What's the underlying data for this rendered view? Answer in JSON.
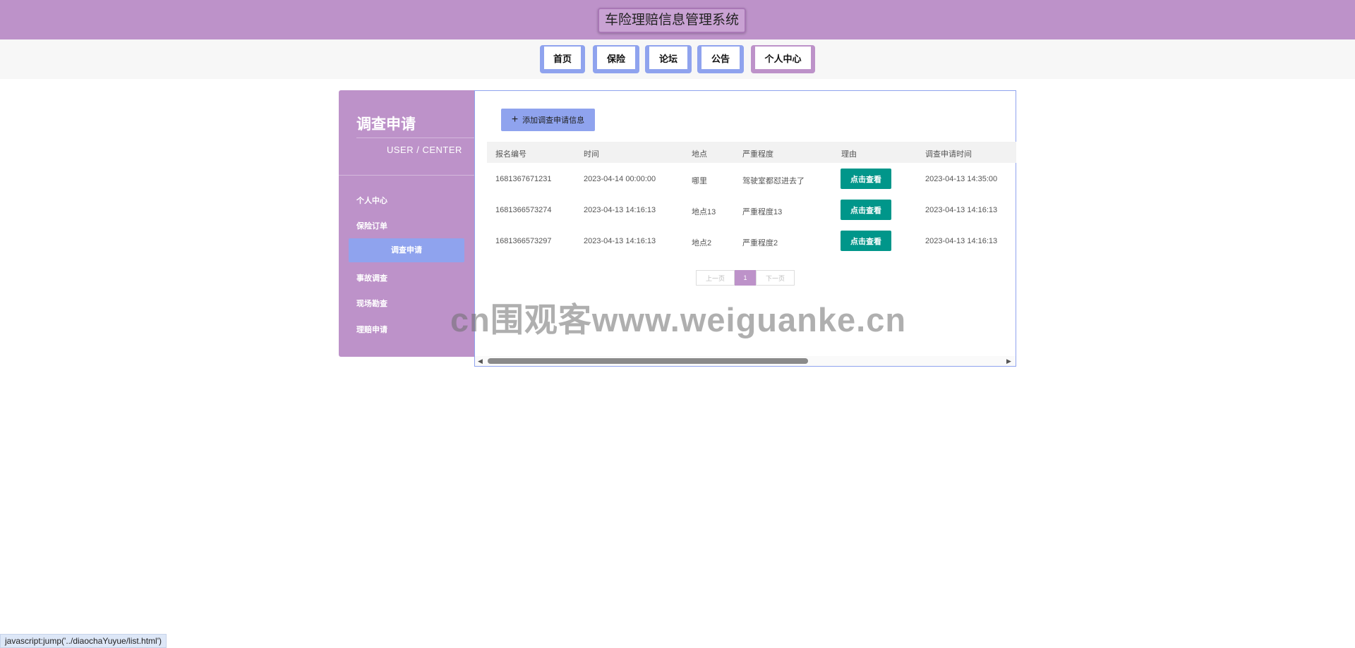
{
  "app": {
    "title": "车险理赔信息管理系统"
  },
  "nav": {
    "tabs": [
      {
        "label": "首页",
        "active": false
      },
      {
        "label": "保险",
        "active": false
      },
      {
        "label": "论坛",
        "active": false
      },
      {
        "label": "公告",
        "active": false
      },
      {
        "label": "个人中心",
        "active": true
      }
    ]
  },
  "sidebar": {
    "title": "调查申请",
    "subtitle": "USER / CENTER",
    "items": [
      {
        "label": "个人中心",
        "active": false
      },
      {
        "label": "保险订单",
        "active": false
      },
      {
        "label": "调查申请",
        "active": true
      },
      {
        "label": "事故调查",
        "active": false
      },
      {
        "label": "现场勘查",
        "active": false
      },
      {
        "label": "理赔申请",
        "active": false
      }
    ]
  },
  "main": {
    "add_button": {
      "icon": "plus-icon",
      "label": "添加调查申请信息"
    },
    "table": {
      "headers": [
        "报名编号",
        "时间",
        "地点",
        "严重程度",
        "理由",
        "调查申请时间"
      ],
      "rows": [
        {
          "id": "1681367671231",
          "time": "2023-04-14 00:00:00",
          "place": "哪里",
          "severity": "驾驶室都怼进去了",
          "reason": "点击查看",
          "apply_time": "2023-04-13 14:35:00"
        },
        {
          "id": "1681366573274",
          "time": "2023-04-13 14:16:13",
          "place": "地点13",
          "severity": "严重程度13",
          "reason": "点击查看",
          "apply_time": "2023-04-13 14:16:13"
        },
        {
          "id": "1681366573297",
          "time": "2023-04-13 14:16:13",
          "place": "地点2",
          "severity": "严重程度2",
          "reason": "点击查看",
          "apply_time": "2023-04-13 14:16:13"
        }
      ]
    },
    "pagination": {
      "prev": "上一页",
      "current": "1",
      "next": "下一页"
    }
  },
  "watermark": "cn围观客www.weiguanke.cn",
  "status_bar": "javascript:jump('../diaochaYuyue/list.html')",
  "colors": {
    "header": "#bd92c9",
    "accent": "#8fa3ee",
    "view_button": "#00968a"
  }
}
